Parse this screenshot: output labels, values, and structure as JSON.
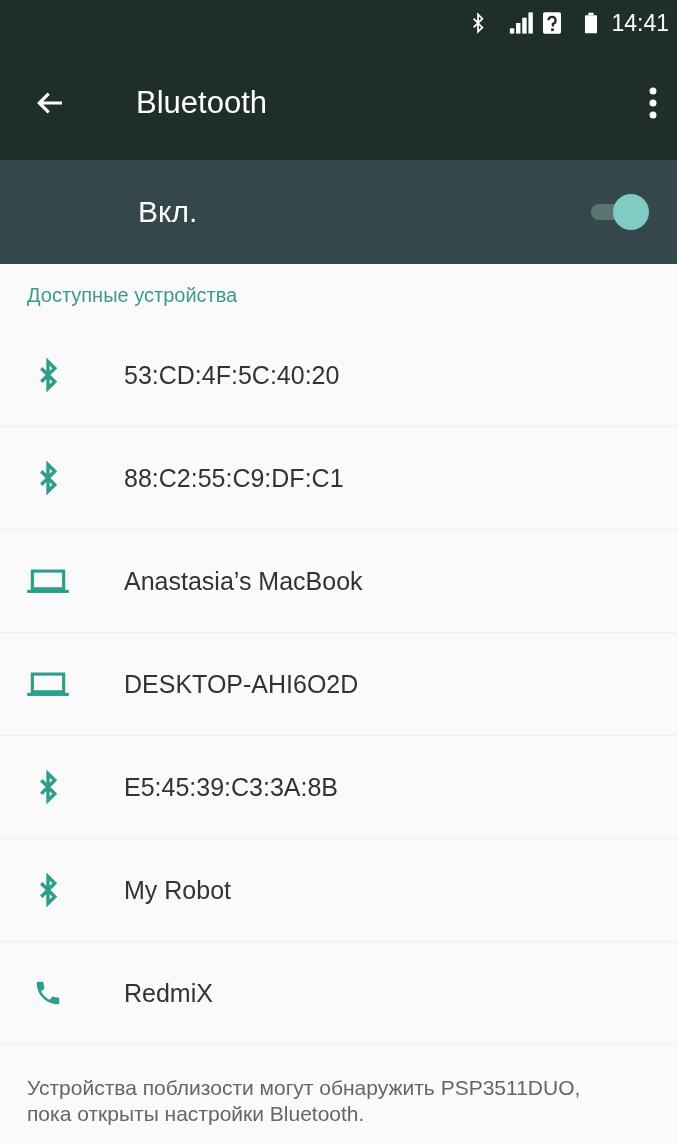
{
  "status_bar": {
    "time": "14:41"
  },
  "toolbar": {
    "title": "Bluetooth"
  },
  "switch_row": {
    "label": "Вкл.",
    "on": true
  },
  "section_header": "Доступные устройства",
  "devices": [
    {
      "name": "53:CD:4F:5C:40:20",
      "kind": "bluetooth"
    },
    {
      "name": "88:C2:55:C9:DF:C1",
      "kind": "bluetooth"
    },
    {
      "name": "Anastasia’s MacBook",
      "kind": "laptop"
    },
    {
      "name": "DESKTOP-AHI6O2D",
      "kind": "laptop"
    },
    {
      "name": "E5:45:39:C3:3A:8B",
      "kind": "bluetooth"
    },
    {
      "name": "My Robot",
      "kind": "bluetooth"
    },
    {
      "name": "RedmiX",
      "kind": "phone"
    }
  ],
  "footer": "Устройства поблизости могут обнаружить PSP3511DUO, пока открыты настройки Bluetooth."
}
